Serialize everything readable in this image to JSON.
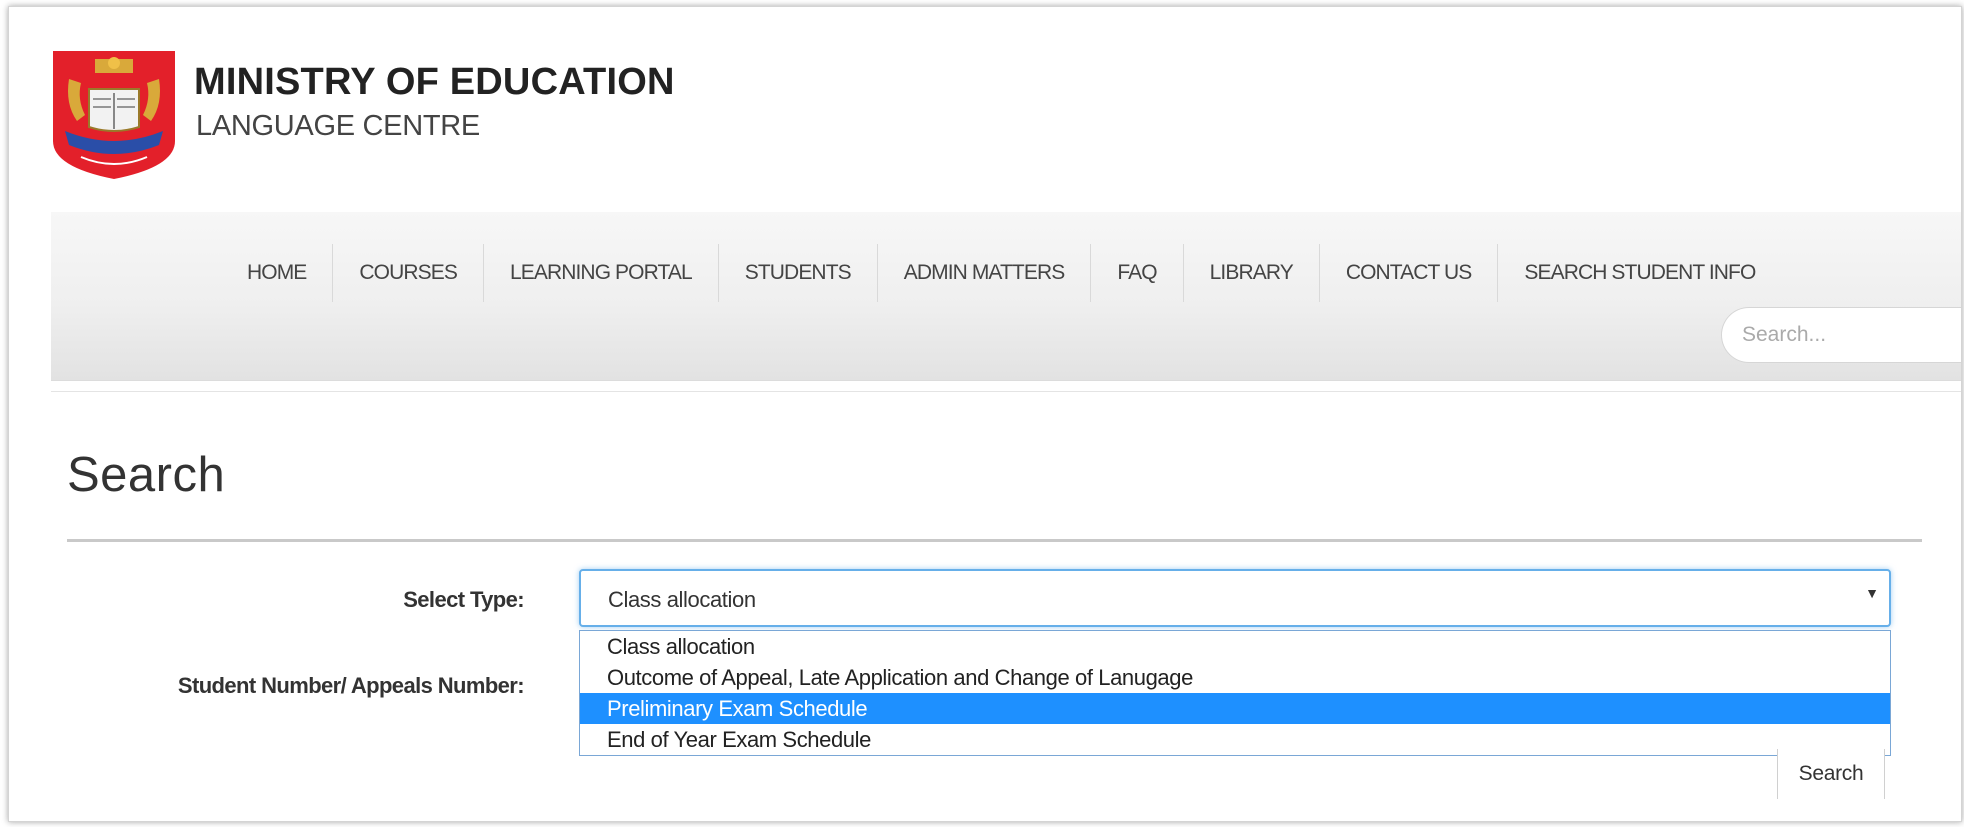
{
  "header": {
    "title": "MINISTRY OF EDUCATION",
    "subtitle": "LANGUAGE CENTRE",
    "logo_icon": "crest-logo-icon"
  },
  "nav": {
    "items": [
      {
        "label": "HOME"
      },
      {
        "label": "COURSES"
      },
      {
        "label": "LEARNING PORTAL"
      },
      {
        "label": "STUDENTS"
      },
      {
        "label": "ADMIN MATTERS"
      },
      {
        "label": "FAQ"
      },
      {
        "label": "LIBRARY"
      },
      {
        "label": "CONTACT US"
      },
      {
        "label": "SEARCH STUDENT INFO"
      }
    ],
    "search_placeholder": "Search..."
  },
  "main": {
    "title": "Search",
    "form": {
      "type_label": "Select Type:",
      "type_selected": "Class allocation",
      "type_options": [
        "Class allocation",
        "Outcome of Appeal, Late Application and Change of Lanugage",
        "Preliminary Exam Schedule",
        "End of Year Exam Schedule"
      ],
      "highlighted_option_index": 2,
      "number_label": "Student Number/ Appeals Number:",
      "search_button": "Search"
    }
  },
  "colors": {
    "focus_border": "#66afe9",
    "option_highlight": "#1e90ff",
    "logo_red": "#e3202a"
  }
}
